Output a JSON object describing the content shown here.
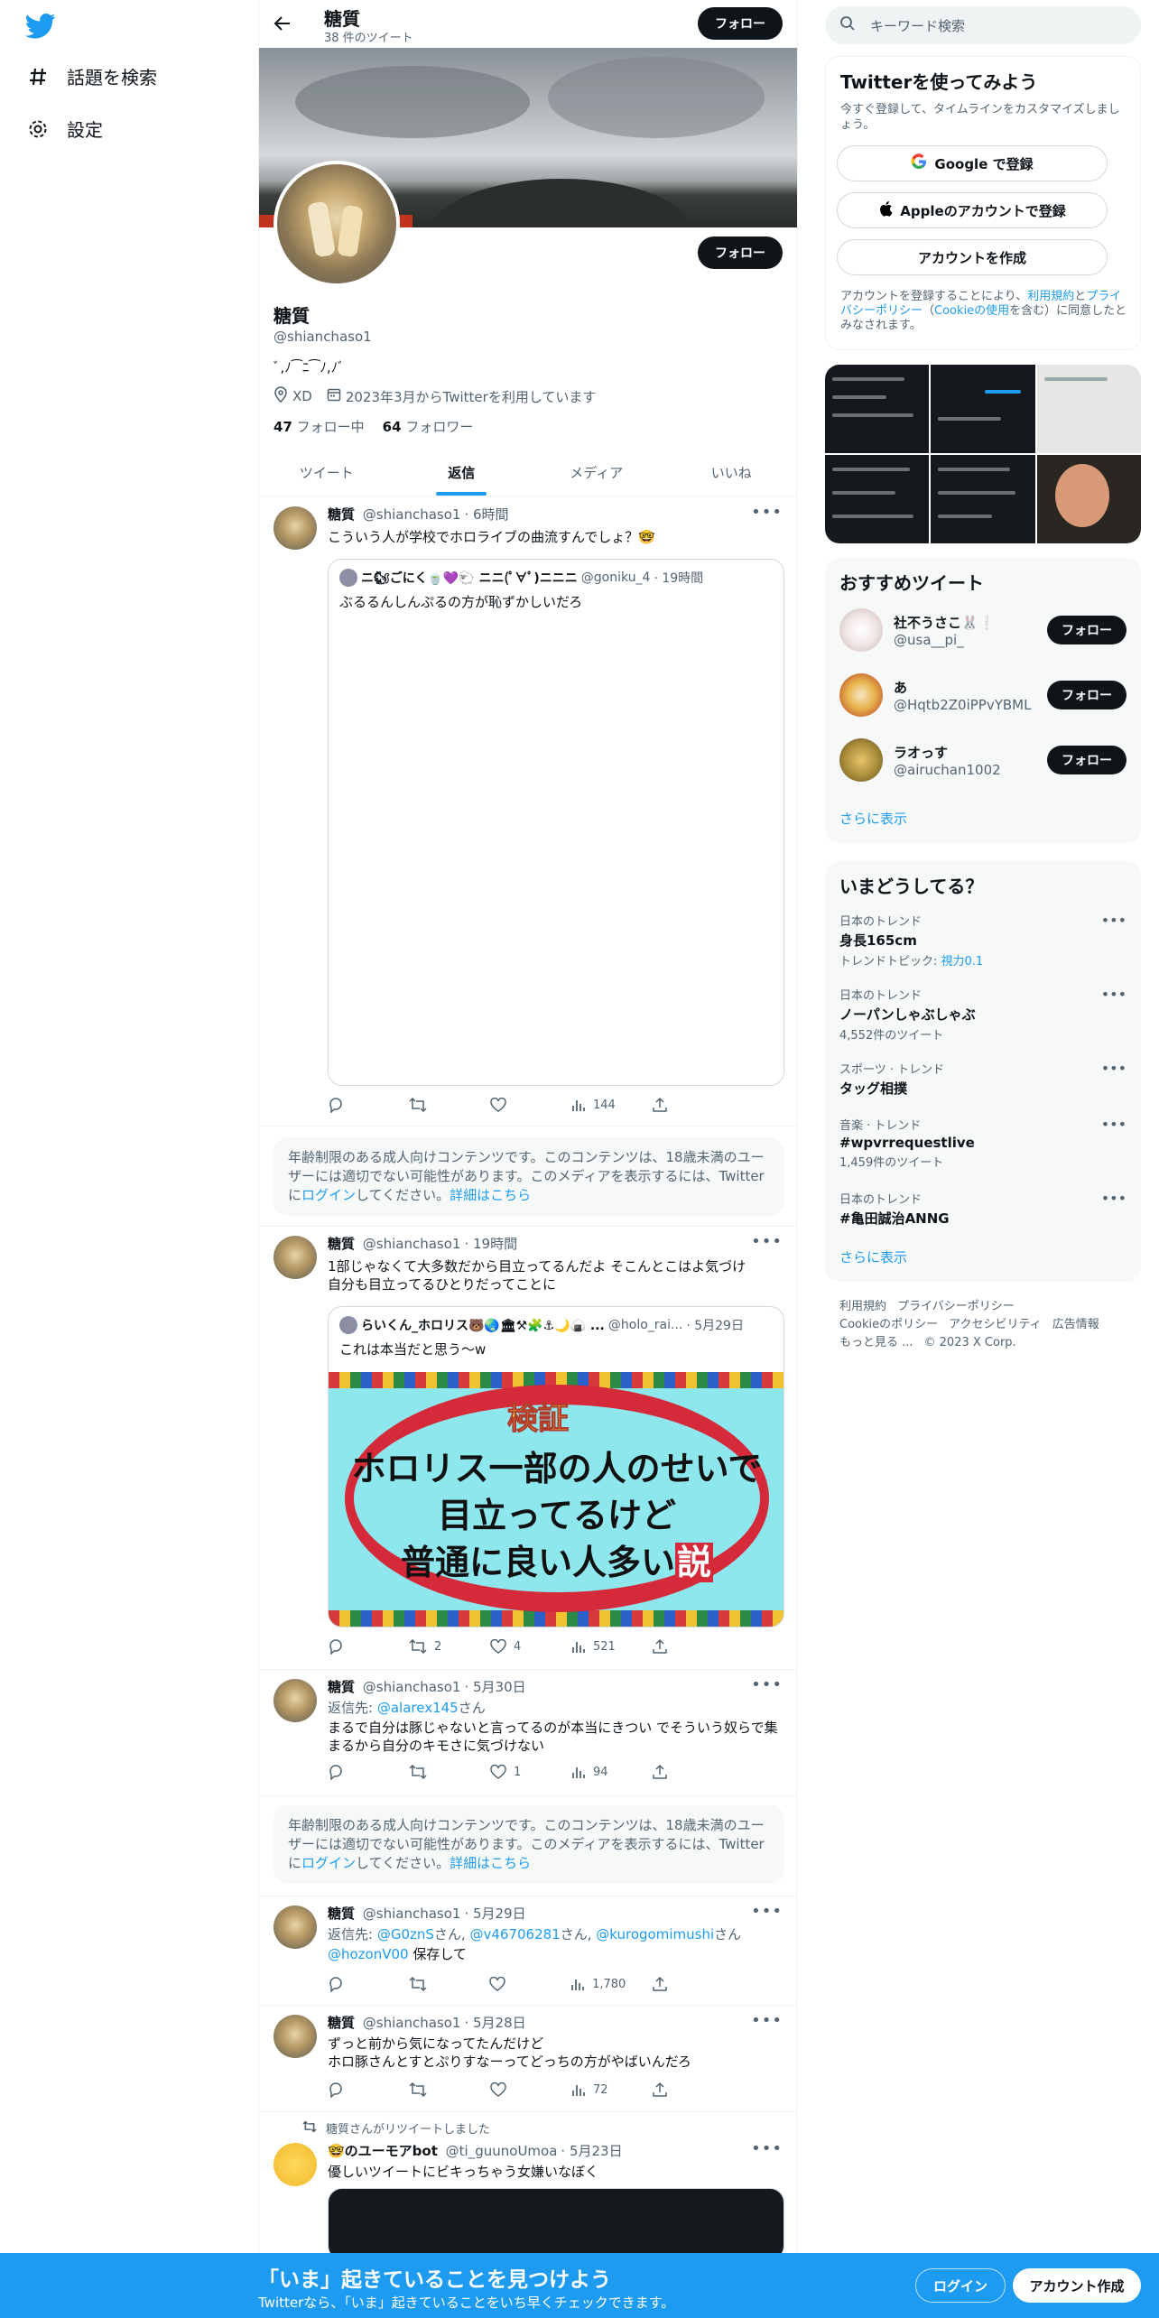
{
  "nav": {
    "explore": "話題を検索",
    "settings": "設定"
  },
  "header": {
    "name": "糖質",
    "tweet_count": "38 件のツイート",
    "follow": "フォロー"
  },
  "profile": {
    "name": "糖質",
    "handle": "@shianchaso1",
    "bio": "ﾞ,ﾉ⁀ﾆ⁀ﾉ,ﾉﾞ",
    "location": "XD",
    "joined": "2023年3月からTwitterを利用しています",
    "following_count": "47",
    "following_label": "フォロー中",
    "followers_count": "64",
    "followers_label": "フォロワー",
    "follow": "フォロー"
  },
  "tabs": [
    "ツイート",
    "返信",
    "メディア",
    "いいね"
  ],
  "tweets": [
    {
      "name": "糖質",
      "handle": "@shianchaso1",
      "time": "· 6時間",
      "text": "こういう人が学校でホロライブの曲流すんでしょ？🤓",
      "quote": {
        "name": "ニ🐿ごにく🍵💜🐑 ニニ(ﾟ∀ﾟ)ニニニ",
        "handle": "@goniku_4",
        "time": "· 19時間",
        "text": "ぶるるんしんぷるの方が恥ずかしいだろ"
      },
      "views": "144"
    },
    {
      "name": "糖質",
      "handle": "@shianchaso1",
      "time": "· 19時間",
      "text_line1": "1部じゃなくて大多数だから目立ってるんだよ そこんとこはよ気づけ",
      "text_line2": "自分も目立ってるひとりだってことに",
      "quote": {
        "name": "らいくん_ホロリス🐻🌏🏛⚒🧩⚓🌙🍙 ...",
        "handle": "@holo_rai...",
        "time": "· 5月29日",
        "text": "これは本当だと思う〜w",
        "image_badge": "検証",
        "image_line1": "ホロリス一部の人のせいで",
        "image_line2": "目立ってるけど",
        "image_line3": "普通に良い人多い",
        "image_setsu": "説"
      },
      "retweets": "2",
      "likes": "4",
      "views": "521"
    },
    {
      "name": "糖質",
      "handle": "@shianchaso1",
      "time": "· 5月30日",
      "reply_label": "返信先:",
      "reply_to": "@alarex145",
      "reply_suffix": "さん",
      "text_line1": "まるで自分は豚じゃないと言ってるのが本当にきつい でそういう奴らで集",
      "text_line2": "まるから自分のキモさに気づけない",
      "likes": "1",
      "views": "94"
    },
    {
      "name": "糖質",
      "handle": "@shianchaso1",
      "time": "· 5月29日",
      "reply_label": "返信先:",
      "reply_to1": "@G0znS",
      "reply_to2": "@v46706281",
      "reply_to3": "@kurogomimushi",
      "reply_to4": "@hozonV00",
      "san": "さん,",
      "san_last": "さん",
      "text": "保存して",
      "views": "1,780"
    },
    {
      "name": "糖質",
      "handle": "@shianchaso1",
      "time": "· 5月28日",
      "text_line1": "ずっと前から気になってたんだけど",
      "text_line2": "ホロ豚さんとすとぷりすなーってどっちの方がやばいんだろ",
      "views": "72"
    },
    {
      "retweeted_by": "糖質さんがリツイートしました",
      "name": "🤓のユーモアbot",
      "handle": "@ti_guunoUmoa",
      "time": "· 5月23日",
      "text": "優しいツイートにビキっちゃう女嫌いなぼく"
    }
  ],
  "warning": {
    "text_a": "年齢制限のある成人向けコンテンツです。このコンテンツは、18歳未満のユーザーには適切でない可能性があります。このメディアを表示するには、Twitter",
    "text_b": "に",
    "login": "ログイン",
    "text_c": "してください。",
    "details": "詳細はこちら"
  },
  "sidebar": {
    "search_placeholder": "キーワード検索",
    "signup_card": {
      "title": "Twitterを使ってみよう",
      "subtitle": "今すぐ登録して、タイムラインをカスタマイズしましょう。",
      "google": "Google で登録",
      "apple": "Appleのアカウントで登録",
      "create": "アカウントを作成",
      "legal_a": "アカウントを登録することにより、",
      "legal_terms": "利用規約",
      "legal_b": "と",
      "legal_privacy": "プライバシーポリシー",
      "legal_c": "（",
      "legal_cookie": "Cookieの使用",
      "legal_d": "を含む）に同意したとみなされます。"
    },
    "recommended": {
      "title": "おすすめツイート",
      "users": [
        {
          "name": "社不うさこ🐰❕",
          "handle": "@usa__pi_"
        },
        {
          "name": "あ",
          "handle": "@Hqtb2Z0iPPvYBML"
        },
        {
          "name": "ラオっす",
          "handle": "@airuchan1002"
        }
      ],
      "follow": "フォロー",
      "more": "さらに表示"
    },
    "trends": {
      "title": "いまどうしてる？",
      "items": [
        {
          "context": "日本のトレンド",
          "name": "身長165cm",
          "sub_label": "トレンドトピック: ",
          "sub_link": "視力0.1"
        },
        {
          "context": "日本のトレンド",
          "name": "ノーパンしゃぶしゃぶ",
          "sub": "4,552件のツイート"
        },
        {
          "context": "スポーツ · トレンド",
          "name": "タッグ相撲"
        },
        {
          "context": "音楽 · トレンド",
          "name": "#wpvrrequestlive",
          "sub": "1,459件のツイート"
        },
        {
          "context": "日本のトレンド",
          "name": "#亀田誠治ANNG"
        }
      ],
      "more": "さらに表示"
    },
    "footer": {
      "terms": "利用規約",
      "privacy": "プライバシーポリシー",
      "cookie": "Cookieのポリシー",
      "access": "アクセシビリティ",
      "ads": "広告情報",
      "more": "もっと見る ...",
      "copy": "© 2023 X Corp."
    }
  },
  "bottom": {
    "title": "「いま」起きていることを見つけよう",
    "subtitle": "Twitterなら、「いま」起きていることをいち早くチェックできます。",
    "login": "ログイン",
    "signup": "アカウント作成"
  },
  "colors": {
    "accent": "#1d9bf0",
    "dark": "#0f1419",
    "muted": "#536471"
  }
}
